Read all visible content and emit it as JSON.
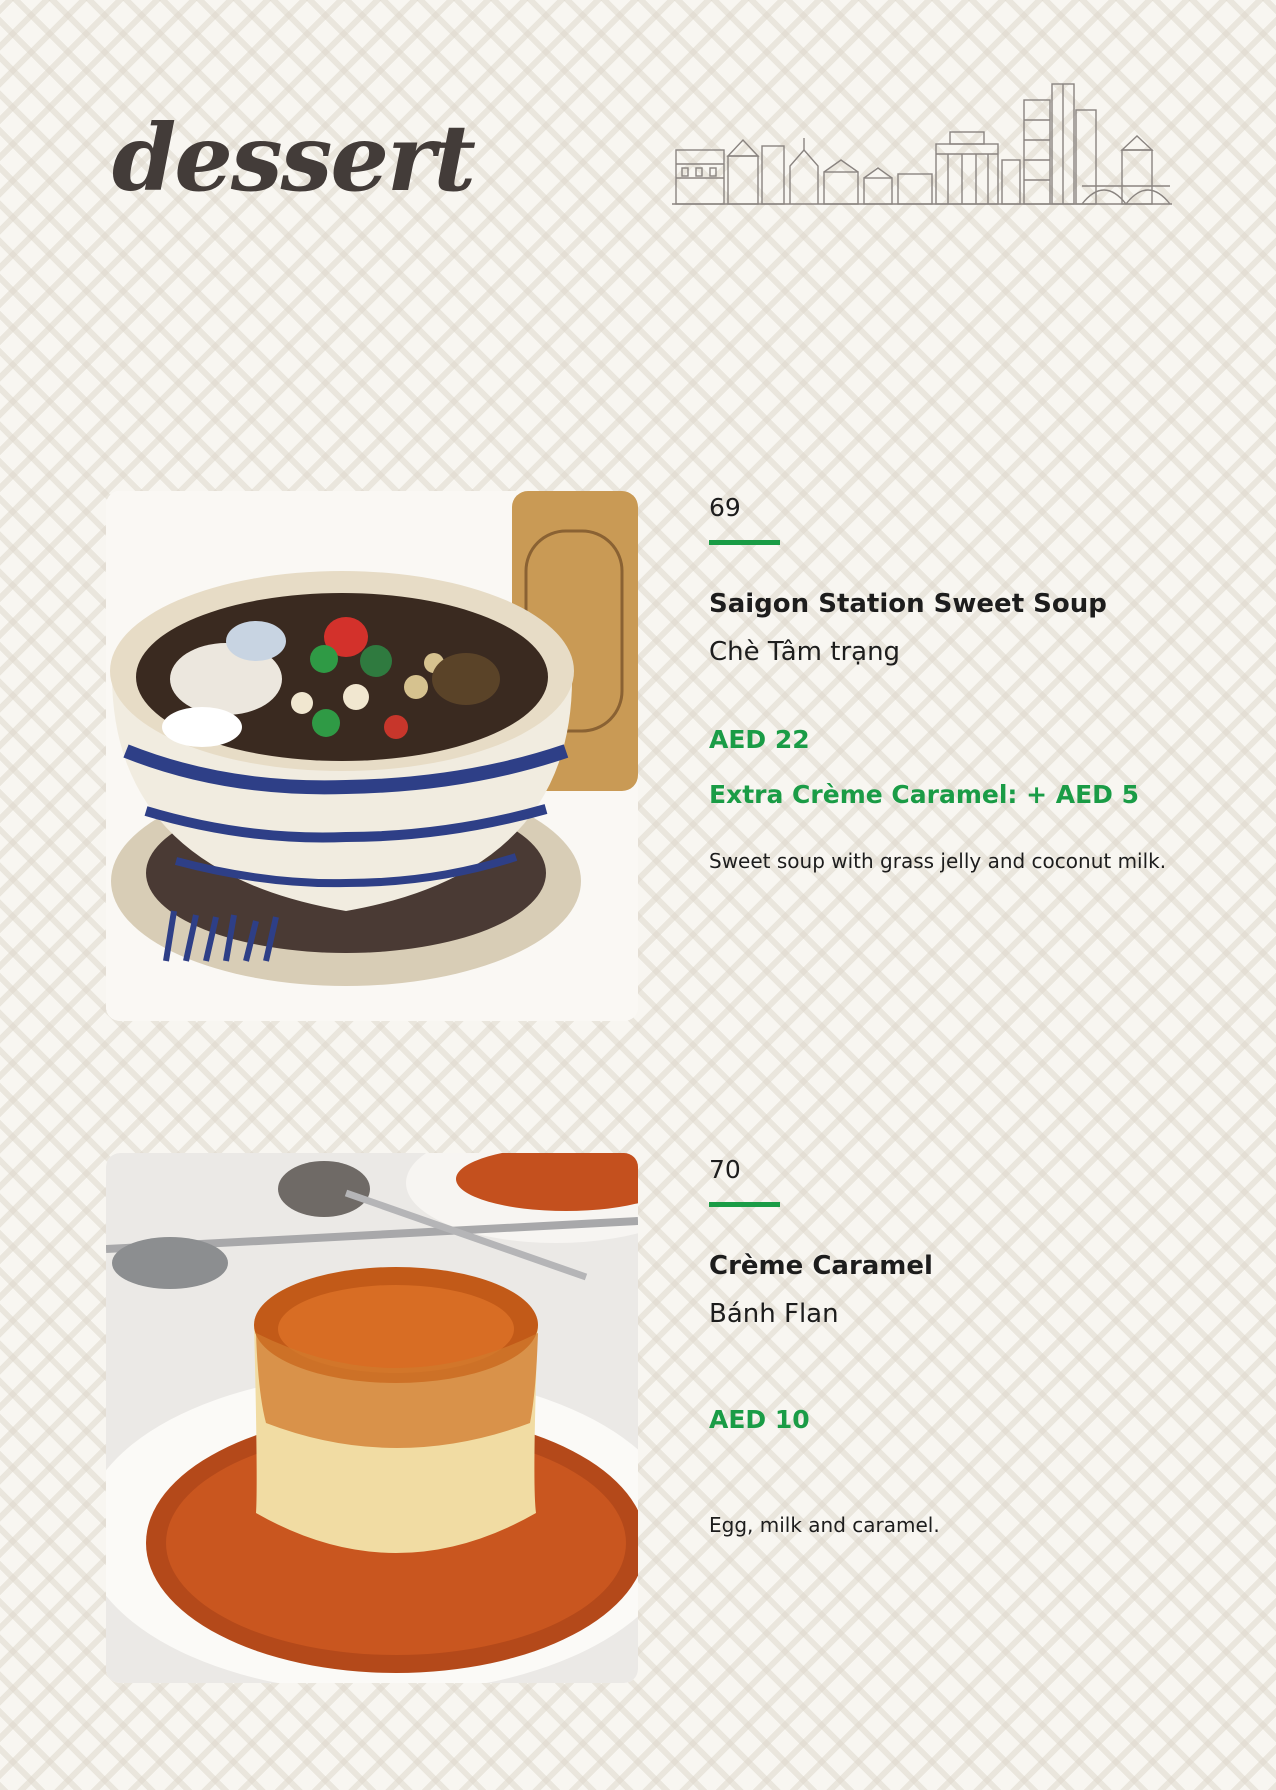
{
  "page": {
    "title": "dessert",
    "accent_color": "#1a9c46",
    "title_color": "#433c39"
  },
  "header": {
    "skyline_icon": "city-skyline-sketch"
  },
  "items": [
    {
      "number": "69",
      "name": "Saigon Station Sweet Soup",
      "vietnamese_name": "Chè Tâm trạng",
      "price": "AED 22",
      "extra": "Extra Crème Caramel: + AED 5",
      "description": "Sweet soup with grass jelly and coconut milk.",
      "photo": "sweet-soup-bowl-photo"
    },
    {
      "number": "70",
      "name": "Crème Caramel",
      "vietnamese_name": "Bánh Flan",
      "price": "AED 10",
      "description": "Egg, milk and caramel.",
      "photo": "creme-caramel-photo"
    }
  ]
}
